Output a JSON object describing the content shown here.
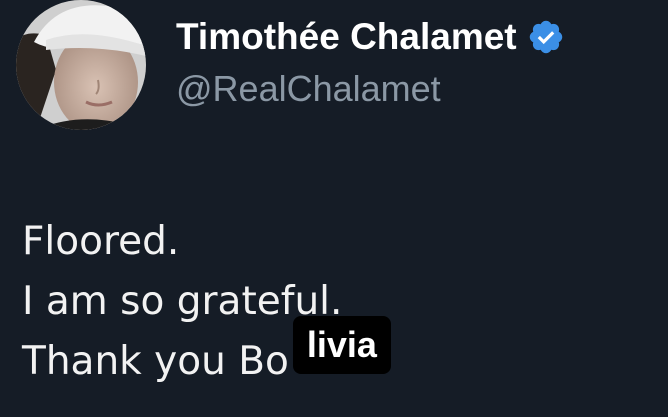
{
  "author": {
    "display_name": "Timothée Chalamet",
    "handle": "@RealChalamet",
    "verified_icon": "verified-badge-icon",
    "verified_color": "#3b8fe6"
  },
  "tweet": {
    "lines": [
      "Floored.",
      "I am so grateful.",
      "Thank you Bo"
    ],
    "overlay_text": "livia"
  },
  "colors": {
    "background": "#151c26",
    "text": "#f2f2f2",
    "handle": "#8b98a5"
  }
}
